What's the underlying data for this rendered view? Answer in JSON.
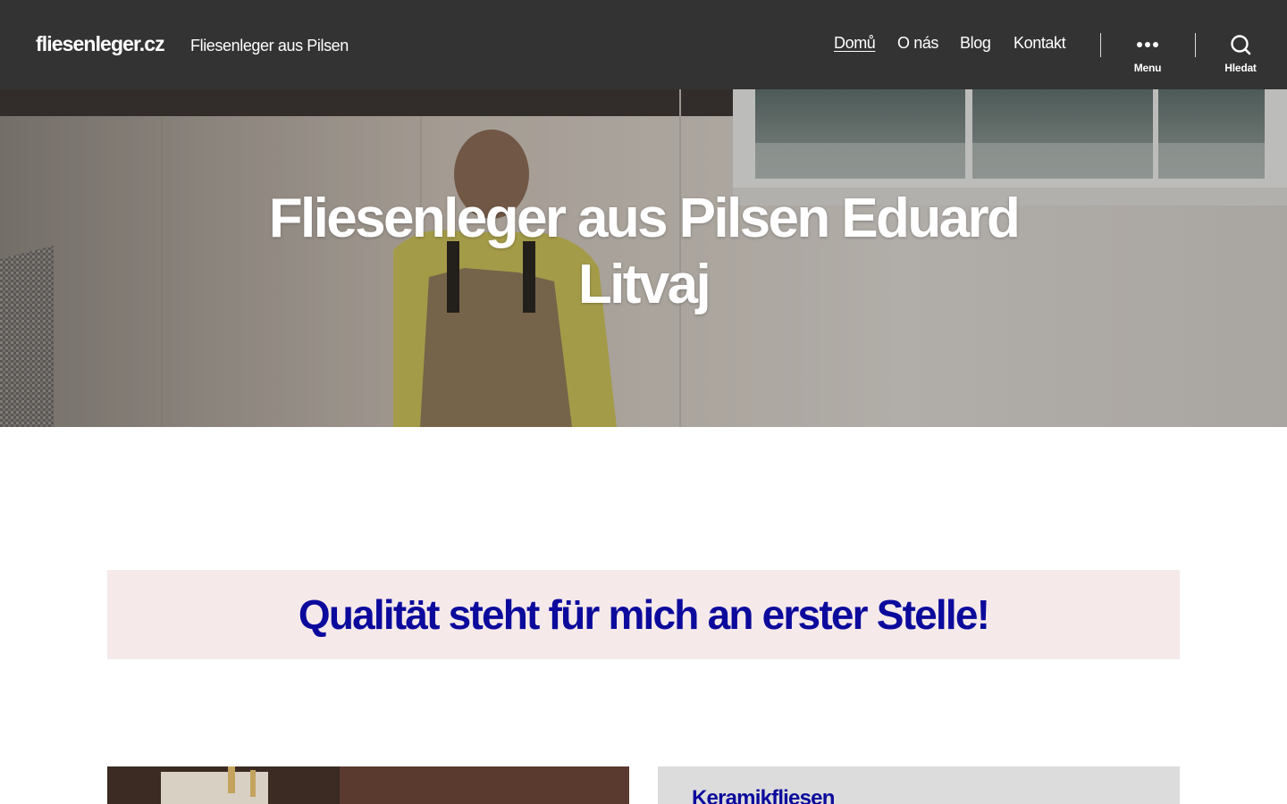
{
  "header": {
    "site_title": "fliesenleger.cz",
    "site_description": "Fliesenleger aus Pilsen",
    "nav": [
      {
        "label": "Domů",
        "current": true
      },
      {
        "label": "O nás",
        "current": false
      },
      {
        "label": "Blog",
        "current": false
      },
      {
        "label": "Kontakt",
        "current": false
      }
    ],
    "menu_toggle_label": "Menu",
    "menu_toggle_icon": "ellipsis-icon",
    "search_toggle_label": "Hledat",
    "search_toggle_icon": "search-icon",
    "background_color": "#333333"
  },
  "hero": {
    "title": "Fliesenleger aus Pilsen Eduard Litvaj"
  },
  "main": {
    "quality_banner": {
      "text": "Qualität steht für mich an erster Stelle!",
      "text_color": "#0c0a9c",
      "background_color": "#f5e9ea"
    },
    "cards": [
      {
        "heading": "Keramikfliesen"
      }
    ]
  }
}
